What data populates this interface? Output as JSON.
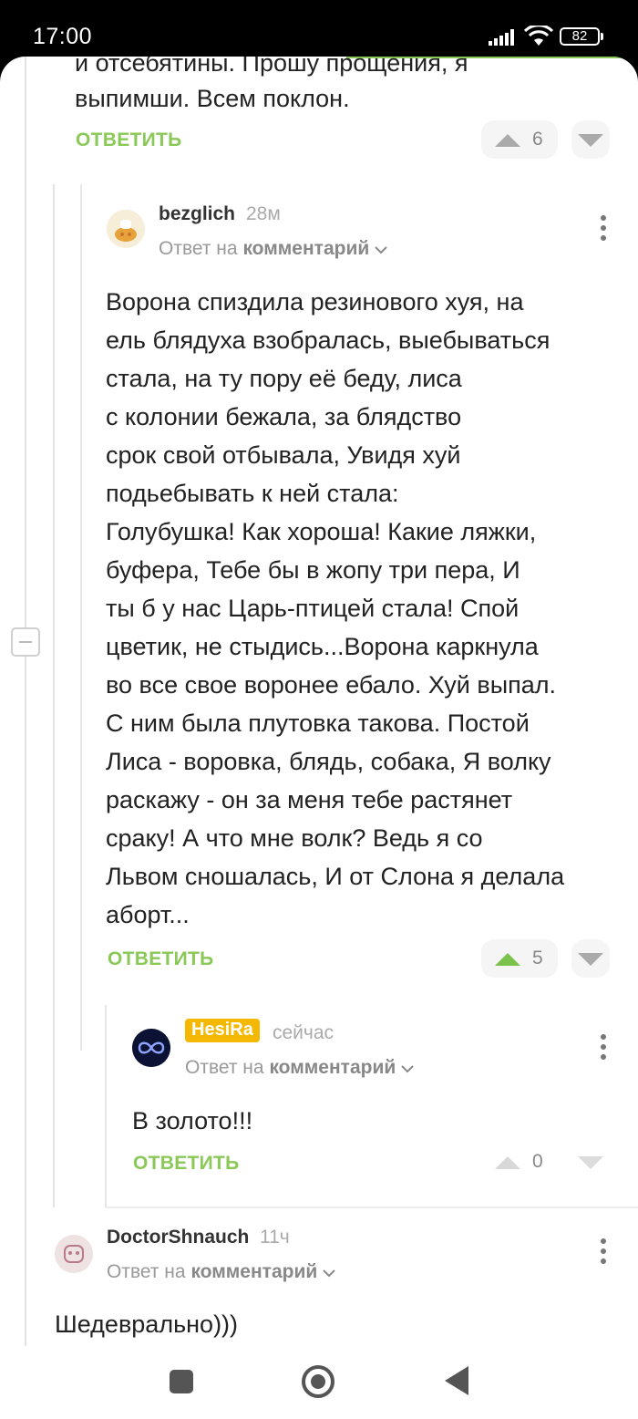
{
  "status_bar": {
    "time": "17:00",
    "battery": "82"
  },
  "comments": {
    "c0": {
      "text_line1": "и отсебятины. Прошу прощения, я",
      "text_line2": "выпимши. Всем поклон.",
      "reply_label": "ОТВЕТИТЬ",
      "votes": "6"
    },
    "c1": {
      "author": "bezglich",
      "time": "28м",
      "reply_prefix": "Ответ на",
      "reply_target": "комментарий",
      "lines": [
        "Ворона спиздила резинового хуя, на",
        "ель блядуха взобралась, выебываться",
        "стала, на ту пору её беду, лиса",
        "с колонии бежала, за блядство",
        "срок свой отбывала, Увидя хуй",
        "подьебывать к ней стала:",
        "Голубушка! Как хороша! Какие ляжки,",
        "буфера, Тебе бы в жопу три пера, И",
        "ты б у нас Царь-птицей стала! Спой",
        "цветик, не стыдись...Ворона каркнула",
        "во все свое воронее ебало. Хуй выпал.",
        "С ним была плутовка такова. Постой",
        "Лиса - воровка, блядь, собака, Я волку",
        "раскажу - он за меня тебе растянет",
        "сраку! А что мне волк? Ведь я со",
        "Львом сношалась, И от Слона я делала",
        "аборт..."
      ],
      "reply_label": "ОТВЕТИТЬ",
      "votes": "5"
    },
    "c2": {
      "author": "HesiRa",
      "time": "сейчас",
      "reply_prefix": "Ответ на",
      "reply_target": "комментарий",
      "text": "В золото!!!",
      "reply_label": "ОТВЕТИТЬ",
      "votes": "0"
    },
    "c3": {
      "author": "DoctorShnauch",
      "time": "11ч",
      "reply_prefix": "Ответ на",
      "reply_target": "комментарий",
      "text": "Шедеврально)))"
    }
  },
  "colors": {
    "accent": "#8ac858",
    "badge": "#f5b800"
  }
}
